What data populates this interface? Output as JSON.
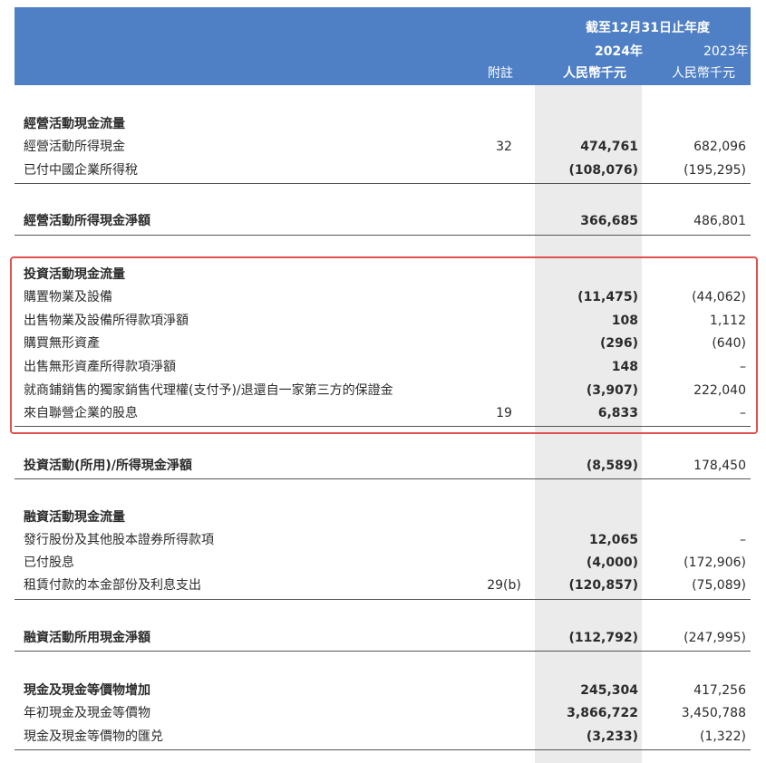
{
  "header": {
    "period_label": "截至12月31日止年度",
    "year_2024": "2024年",
    "year_2023": "2023年",
    "note_label": "附註",
    "unit_2024": "人民幣千元",
    "unit_2023": "人民幣千元"
  },
  "rows": [
    {
      "label": "經營活動現金流量",
      "note": "",
      "v24": "",
      "v23": ""
    },
    {
      "label": "經營活動所得現金",
      "note": "32",
      "v24": "474,761",
      "v23": "682,096"
    },
    {
      "label": "已付中國企業所得稅",
      "note": "",
      "v24": "(108,076)",
      "v23": "(195,295)"
    },
    {
      "label": "經營活動所得現金淨額",
      "note": "",
      "v24": "366,685",
      "v23": "486,801"
    },
    {
      "label": "投資活動現金流量",
      "note": "",
      "v24": "",
      "v23": ""
    },
    {
      "label": "購置物業及設備",
      "note": "",
      "v24": "(11,475)",
      "v23": "(44,062)"
    },
    {
      "label": "出售物業及設備所得款項淨額",
      "note": "",
      "v24": "108",
      "v23": "1,112"
    },
    {
      "label": "購買無形資產",
      "note": "",
      "v24": "(296)",
      "v23": "(640)"
    },
    {
      "label": "出售無形資產所得款項淨額",
      "note": "",
      "v24": "148",
      "v23": "–"
    },
    {
      "label": "就商鋪銷售的獨家銷售代理權(支付予)/退還自一家第三方的保證金",
      "note": "",
      "v24": "(3,907)",
      "v23": "222,040"
    },
    {
      "label": "來自聯營企業的股息",
      "note": "19",
      "v24": "6,833",
      "v23": "–"
    },
    {
      "label": "投資活動(所用)/所得現金淨額",
      "note": "",
      "v24": "(8,589)",
      "v23": "178,450"
    },
    {
      "label": "融資活動現金流量",
      "note": "",
      "v24": "",
      "v23": ""
    },
    {
      "label": "發行股份及其他股本證券所得款項",
      "note": "",
      "v24": "12,065",
      "v23": "–"
    },
    {
      "label": "已付股息",
      "note": "",
      "v24": "(4,000)",
      "v23": "(172,906)"
    },
    {
      "label": "租賃付款的本金部份及利息支出",
      "note": "29(b)",
      "v24": "(120,857)",
      "v23": "(75,089)"
    },
    {
      "label": "融資活動所用現金淨額",
      "note": "",
      "v24": "(112,792)",
      "v23": "(247,995)"
    },
    {
      "label": "現金及現金等價物增加",
      "note": "",
      "v24": "245,304",
      "v23": "417,256"
    },
    {
      "label": "年初現金及現金等價物",
      "note": "",
      "v24": "3,866,722",
      "v23": "3,450,788"
    },
    {
      "label": "現金及現金等價物的匯兑",
      "note": "",
      "v24": "(3,233)",
      "v23": "(1,322)"
    }
  ]
}
